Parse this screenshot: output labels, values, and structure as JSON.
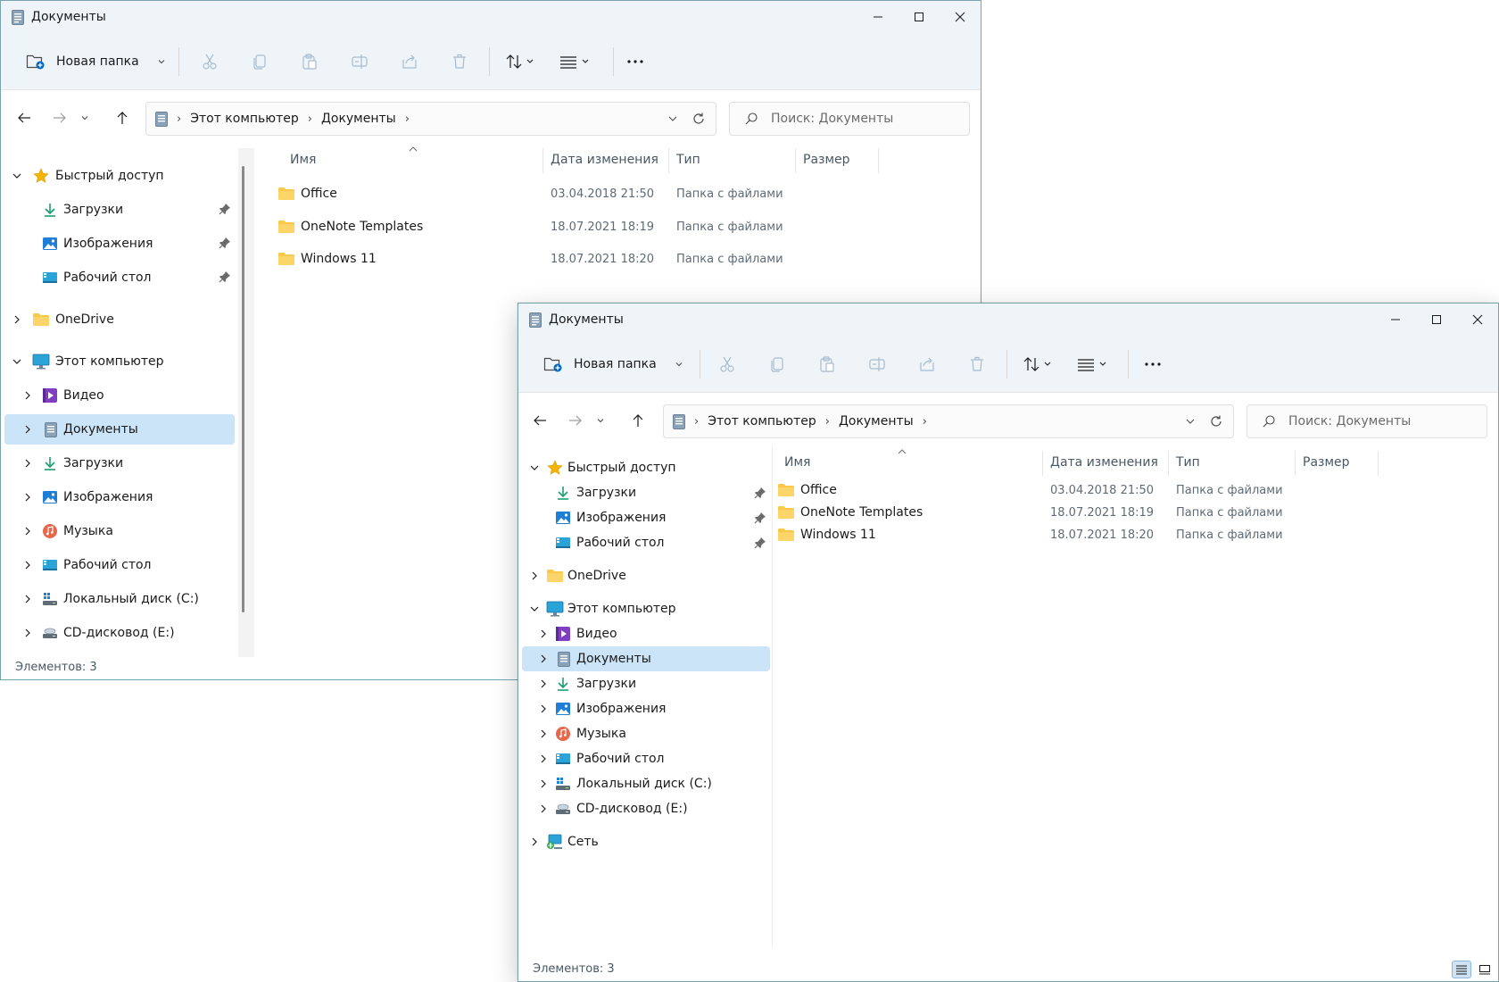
{
  "window": {
    "title": "Документы",
    "controls": [
      "minimize-icon",
      "maximize-icon",
      "close-icon"
    ]
  },
  "toolbar": {
    "new_folder_label": "Новая папка",
    "buttons": [
      "cut-icon",
      "copy-icon",
      "paste-icon",
      "rename-icon",
      "share-icon",
      "delete-icon",
      "sort-icon",
      "view-icon",
      "more-icon"
    ]
  },
  "address": {
    "crumbs": [
      "Этот компьютер",
      "Документы"
    ],
    "search_placeholder": "Поиск: Документы"
  },
  "nav": {
    "quick_access": "Быстрый доступ",
    "qa_downloads": "Загрузки",
    "qa_pictures": "Изображения",
    "qa_desktop": "Рабочий стол",
    "onedrive": "OneDrive",
    "this_pc": "Этот компьютер",
    "video": "Видео",
    "documents": "Документы",
    "downloads": "Загрузки",
    "pictures": "Изображения",
    "music": "Музыка",
    "desktop": "Рабочий стол",
    "local_disk": "Локальный диск (C:)",
    "cd_drive": "CD-дисковод (E:)",
    "network": "Сеть"
  },
  "columns": {
    "name": "Имя",
    "date": "Дата изменения",
    "type": "Тип",
    "size": "Размер"
  },
  "files": [
    {
      "name": "Office",
      "date": "03.04.2018 21:50",
      "type": "Папка с файлами"
    },
    {
      "name": "OneNote Templates",
      "date": "18.07.2021 18:19",
      "type": "Папка с файлами"
    },
    {
      "name": "Windows 11",
      "date": "18.07.2021 18:20",
      "type": "Папка с файлами"
    }
  ],
  "status": {
    "count": "Элементов: 3"
  },
  "colors": {
    "accent": "#0067c0",
    "selection": "#cce4f7",
    "folder": "#f8c94a",
    "chrome": "#eff4f9"
  }
}
